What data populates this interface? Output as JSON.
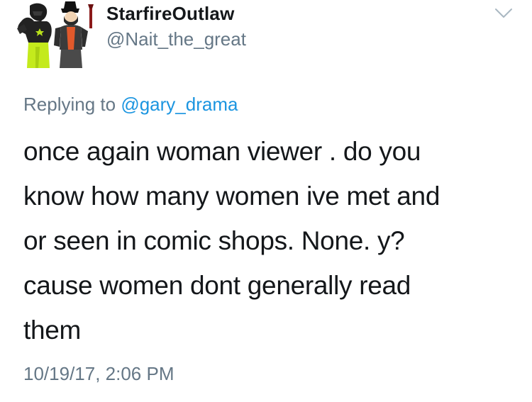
{
  "author": {
    "display_name": "StarfireOutlaw",
    "handle": "@Nait_the_great",
    "avatar_icon": "cartoon-characters-avatar"
  },
  "reply": {
    "prefix": "Replying to",
    "mention": "@gary_drama"
  },
  "tweet": {
    "lines": [
      "once again woman viewer . do you",
      "know how many women ive met and",
      "or seen in comic shops. None. y?",
      "cause women dont generally read",
      "them"
    ]
  },
  "timestamp": "10/19/17, 2:06 PM",
  "menu": {
    "icon": "chevron-down-icon"
  },
  "colors": {
    "text": "#14171a",
    "secondary": "#657786",
    "link": "#1b95e0",
    "chevron": "#aab8c2"
  }
}
